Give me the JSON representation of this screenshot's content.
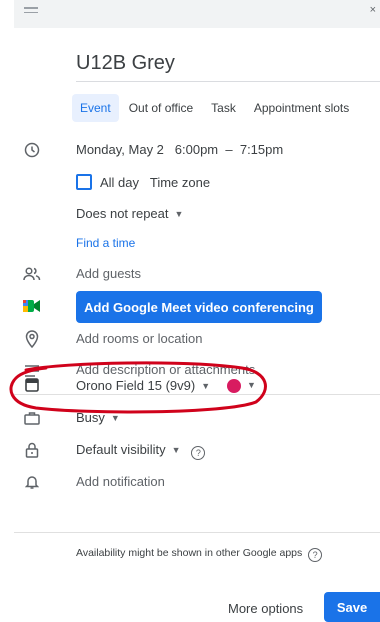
{
  "event": {
    "title": "U12B Grey",
    "tabs": [
      "Event",
      "Out of office",
      "Task",
      "Appointment slots"
    ],
    "datetime": {
      "date": "Monday, May 2",
      "start": "6:00pm",
      "separator": "–",
      "end": "7:15pm"
    },
    "all_day_label": "All day",
    "time_zone_label": "Time zone",
    "repeat_label": "Does not repeat",
    "find_time_label": "Find a time",
    "add_guests_placeholder": "Add guests",
    "meet_button_label": "Add Google Meet video conferencing",
    "location_placeholder": "Add rooms or location",
    "description_placeholder": "Add description or attachments",
    "calendar_label": "Orono Field 15 (9v9)",
    "calendar_color": "#d81b60",
    "busy_label": "Busy",
    "visibility_label": "Default visibility",
    "notification_label": "Add notification",
    "availability_note": "Availability might be shown in other Google apps",
    "more_options_label": "More options",
    "save_label": "Save"
  },
  "annotation": {
    "color": "#d0021b",
    "shape": "ellipse"
  }
}
